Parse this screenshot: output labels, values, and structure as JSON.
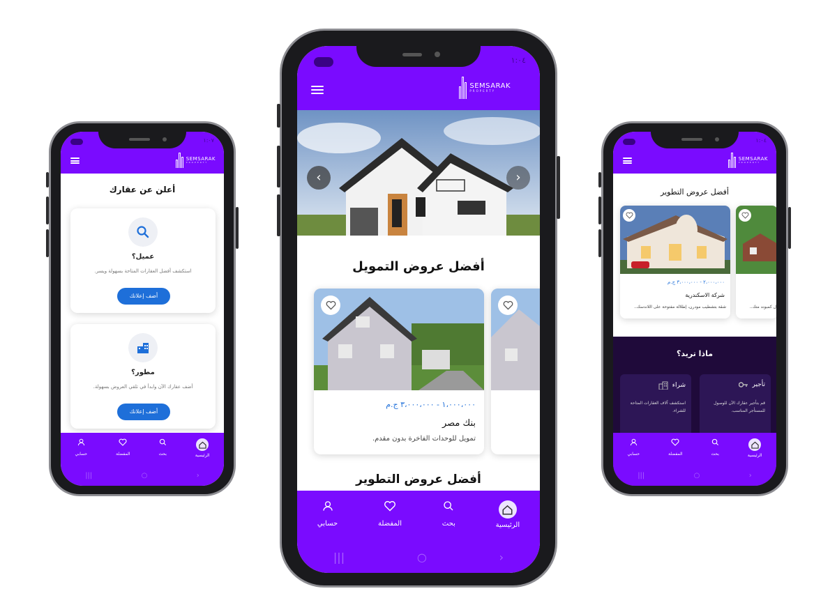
{
  "brand": {
    "name": "SEMSARAK",
    "sub": "PROPERTY"
  },
  "status": {
    "time": "١:٠٧",
    "time_center": "١:٠٤",
    "time_right": "١:٠٤"
  },
  "nav": {
    "home": "الرئيسية",
    "search": "بحث",
    "favorites": "المفضلة",
    "account": "حسابي"
  },
  "left": {
    "title": "أعلن عن عقارك",
    "client": {
      "title": "عميل؟",
      "desc": "استكشف أفضل العقارات المتاحة بسهولة ويسر.",
      "button": "أضف إعلانك"
    },
    "developer": {
      "title": "مطور؟",
      "desc": "أضف عقارك الآن وابدأ في تلقي العروض بسهولة.",
      "button": "أضف إعلانك"
    }
  },
  "center": {
    "section1_title": "أفضل عروض التمويل",
    "section2_title": "أفضل عروض التطوير",
    "offer": {
      "price": "١،٠٠٠،٠٠٠ - ٣،٠٠٠،٠٠٠ ج.م",
      "bank": "بنك مصر",
      "desc": "تمويل للوحدات الفاخرة بدون مقدم."
    }
  },
  "right": {
    "title": "أفضل عروض التطوير",
    "offer": {
      "price": "٢،٠٠٠،٠٠٠ - ٣،٠٠٠،٠٠٠ ج.م",
      "company": "شركة الاسكندرية",
      "desc": "شقة بتشطيب مودرن، إطلالة مفتوحة على اللاندسك..",
      "desc2": "ل كمبوند متك.."
    },
    "want": {
      "title": "ماذا تريد؟",
      "rent_title": "تأجير",
      "rent_desc": "قم بتأجير عقارك الآن للوصول للمستأجر المناسب.",
      "buy_title": "شراء",
      "buy_desc": "استكشف آلاف العقارات المتاحة للشراء."
    }
  },
  "colors": {
    "purple": "#7a0bff",
    "dark_purple": "#1f0a3a",
    "blue": "#1e6fd9"
  }
}
